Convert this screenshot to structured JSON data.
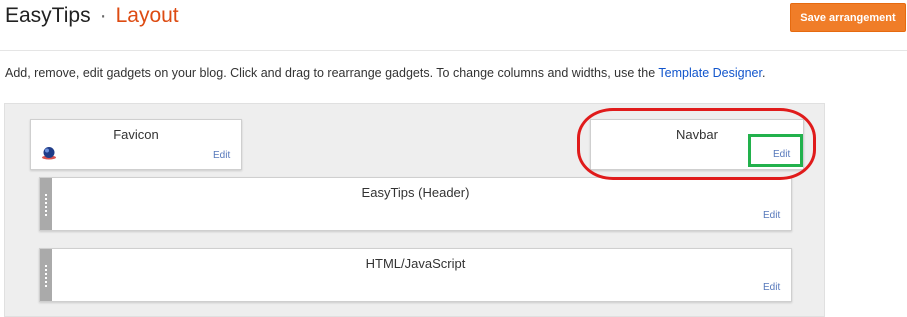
{
  "header": {
    "blog_name": "EasyTips",
    "separator": "·",
    "page_name": "Layout",
    "save_label": "Save arrangement"
  },
  "description": {
    "text": "Add, remove, edit gadgets on your blog. Click and drag to rearrange gadgets. To change columns and widths, use the ",
    "link": "Template Designer",
    "suffix": "."
  },
  "gadgets": {
    "favicon": {
      "name": "Favicon",
      "edit": "Edit",
      "icon": "favicon-globe-icon"
    },
    "navbar": {
      "name": "Navbar",
      "edit": "Edit"
    },
    "header": {
      "name": "EasyTips (Header)",
      "edit": "Edit"
    },
    "html": {
      "name": "HTML/JavaScript",
      "edit": "Edit"
    }
  },
  "colors": {
    "accent": "#dd4b12",
    "button": "#f07d28",
    "link": "#1155cc",
    "annotation_red": "#e01b1b",
    "annotation_green": "#22b14c"
  }
}
